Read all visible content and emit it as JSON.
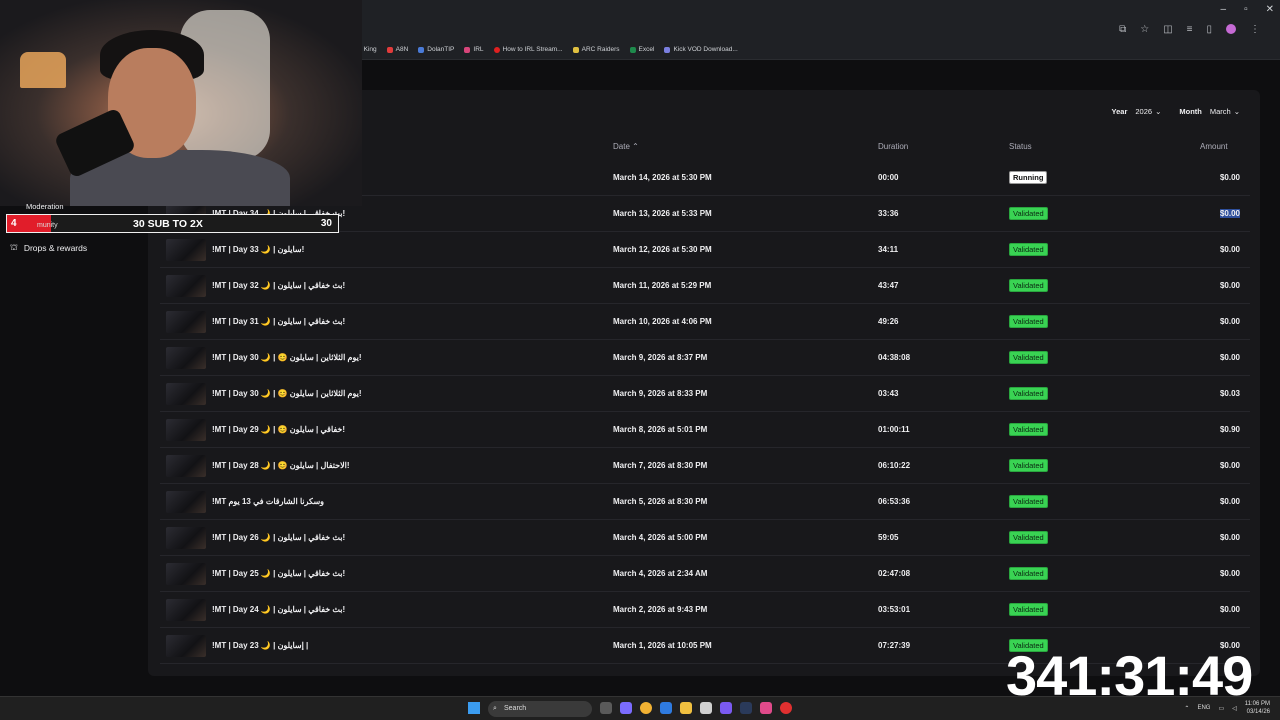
{
  "browser": {
    "bookmarks": [
      "t King",
      "A8N",
      "DolanTIP",
      "IRL",
      "How to IRL Stream...",
      "ARC Raiders",
      "Excel",
      "Kick VOD Download..."
    ]
  },
  "sidebar": {
    "drops_label": "Drops & rewards"
  },
  "overlay": {
    "moderation_label": "Moderation",
    "community_label": "munity",
    "sub_goal": {
      "current": "4",
      "label": "30 SUB TO 2X",
      "target": "30",
      "progress": 0.133
    },
    "timer": "341:31:49"
  },
  "filters": {
    "year_label": "Year",
    "year_value": "2026",
    "month_label": "Month",
    "month_value": "March"
  },
  "table": {
    "headers": {
      "date": "Date",
      "duration": "Duration",
      "status": "Status",
      "amount": "Amount"
    },
    "rows": [
      {
        "title": "",
        "date": "March 14, 2026 at 5:30 PM",
        "duration": "00:00",
        "status": "Running",
        "amount": "$0.00"
      },
      {
        "title": "!MT | Day 34 🌙 | بث خفاقي | سايلون!",
        "date": "March 13, 2026 at 5:33 PM",
        "duration": "33:36",
        "status": "Validated",
        "amount": "$0.00"
      },
      {
        "title": "!MT | Day 33 🌙 | سايلون!",
        "date": "March 12, 2026 at 5:30 PM",
        "duration": "34:11",
        "status": "Validated",
        "amount": "$0.00"
      },
      {
        "title": "!MT | Day 32 🌙 | بث خفاقي | سايلون!",
        "date": "March 11, 2026 at 5:29 PM",
        "duration": "43:47",
        "status": "Validated",
        "amount": "$0.00"
      },
      {
        "title": "!MT | Day 31 🌙 | بث خفاقي | سايلون!",
        "date": "March 10, 2026 at 4:06 PM",
        "duration": "49:26",
        "status": "Validated",
        "amount": "$0.00"
      },
      {
        "title": "!MT | Day 30 🌙 | 😊 يوم الثلاثاين | سايلون!",
        "date": "March 9, 2026 at 8:37 PM",
        "duration": "04:38:08",
        "status": "Validated",
        "amount": "$0.00"
      },
      {
        "title": "!MT | Day 30 🌙 | 😊 يوم الثلاثاين | سايلون!",
        "date": "March 9, 2026 at 8:33 PM",
        "duration": "03:43",
        "status": "Validated",
        "amount": "$0.03"
      },
      {
        "title": "!MT | Day 29 🌙 | 😊 خفاقي | سايلون!",
        "date": "March 8, 2026 at 5:01 PM",
        "duration": "01:00:11",
        "status": "Validated",
        "amount": "$0.90"
      },
      {
        "title": "!MT | Day 28 🌙 | 😊 الاحتفال | سايلون!",
        "date": "March 7, 2026 at 8:30 PM",
        "duration": "06:10:22",
        "status": "Validated",
        "amount": "$0.00"
      },
      {
        "title": "!MT وسكرنا الشارقات في 13 يوم",
        "date": "March 5, 2026 at 8:30 PM",
        "duration": "06:53:36",
        "status": "Validated",
        "amount": "$0.00"
      },
      {
        "title": "!MT | Day 26 🌙 | بث خفاقي | سايلون!",
        "date": "March 4, 2026 at 5:00 PM",
        "duration": "59:05",
        "status": "Validated",
        "amount": "$0.00"
      },
      {
        "title": "!MT | Day 25 🌙 | بث خفاقي | سايلون!",
        "date": "March 4, 2026 at 2:34 AM",
        "duration": "02:47:08",
        "status": "Validated",
        "amount": "$0.00"
      },
      {
        "title": "!MT | Day 24 🌙 | بث خفاقي | سايلون!",
        "date": "March 2, 2026 at 9:43 PM",
        "duration": "03:53:01",
        "status": "Validated",
        "amount": "$0.00"
      },
      {
        "title": "!MT | Day 23 🌙 | إسايلون |",
        "date": "March 1, 2026 at 10:05 PM",
        "duration": "07:27:39",
        "status": "Validated",
        "amount": "$0.00"
      }
    ]
  },
  "taskbar": {
    "search_placeholder": "Search",
    "lang": "ENG",
    "time": "11:06 PM",
    "date": "03/14/26"
  },
  "colors": {
    "validated": "#39d353",
    "running": "#ffffff",
    "sub_bar": "#e11d2a"
  }
}
